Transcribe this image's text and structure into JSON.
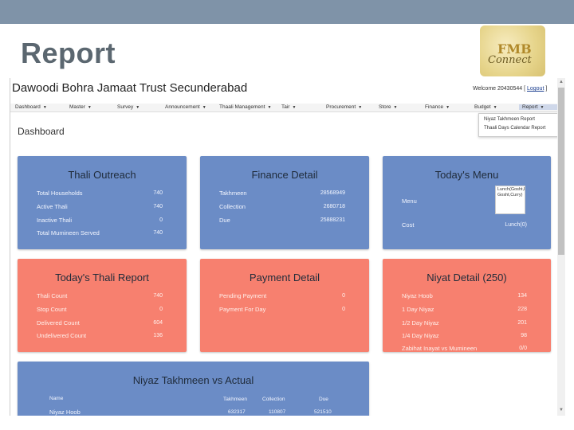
{
  "slide": {
    "title": "Report",
    "logo_line1": "FMB",
    "logo_line2": "Connect"
  },
  "app": {
    "name": "Dawoodi Bohra Jamaat Trust Secunderabad",
    "welcome_text": "Welcome 20430544",
    "logout_label": "Logout",
    "page_title": "Dashboard"
  },
  "nav": {
    "items": [
      "Dashboard",
      "Master",
      "Survey",
      "Announcement",
      "Thaali Management",
      "Tair",
      "Procurement",
      "Store",
      "Finance",
      "Budget",
      "Report"
    ],
    "active": "Report",
    "dropdown": [
      "Niyaz Takhmeen Report",
      "Thaali Days Calendar Report"
    ]
  },
  "cards": {
    "thali_outreach": {
      "title": "Thali Outreach",
      "rows": [
        {
          "label": "Total Households",
          "value": "740"
        },
        {
          "label": "Active Thali",
          "value": "740"
        },
        {
          "label": "Inactive Thali",
          "value": "0"
        },
        {
          "label": "Total Mumineen Served",
          "value": "740"
        }
      ]
    },
    "finance_detail": {
      "title": "Finance Detail",
      "rows": [
        {
          "label": "Takhmeen",
          "value": "28568949"
        },
        {
          "label": "Collection",
          "value": "2680718"
        },
        {
          "label": "Due",
          "value": "25888231"
        }
      ]
    },
    "todays_menu": {
      "title": "Today's Menu",
      "menu_label": "Menu",
      "menu_value": "Lunch(Gosht,Bhuna Gosht,Curry)",
      "cost_label": "Cost",
      "cost_value": "Lunch(0)"
    },
    "todays_thali_report": {
      "title": "Today's Thali Report",
      "rows": [
        {
          "label": "Thali Count",
          "value": "740"
        },
        {
          "label": "Stop Count",
          "value": "0"
        },
        {
          "label": "Delivered Count",
          "value": "604"
        },
        {
          "label": "Undelivered Count",
          "value": "136"
        }
      ]
    },
    "payment_detail": {
      "title": "Payment Detail",
      "rows": [
        {
          "label": "Pending Payment",
          "value": "0"
        },
        {
          "label": "Payment For Day",
          "value": "0"
        }
      ]
    },
    "niyat_detail": {
      "title": "Niyat Detail (250)",
      "rows": [
        {
          "label": "Niyaz Hoob",
          "value": "134"
        },
        {
          "label": "1 Day Niyaz",
          "value": "228"
        },
        {
          "label": "1/2 Day Niyaz",
          "value": "201"
        },
        {
          "label": "1/4 Day Niyaz",
          "value": "98"
        },
        {
          "label": "Zabihat Inayat vs Mumineen",
          "value": "0/0"
        }
      ]
    },
    "niyaz_takhmeen": {
      "title": "Niyaz Takhmeen vs Actual",
      "headers": [
        "Name",
        "Takhmeen",
        "Collection",
        "Due"
      ],
      "rows": [
        {
          "name": "Niyaz Hoob",
          "takhmeen": "632317",
          "collection": "110807",
          "due": "521510"
        }
      ]
    }
  },
  "colors": {
    "blue_card": "#6b8cc6",
    "salmon_card": "#f7806f",
    "top_bar": "#7f93a8"
  }
}
